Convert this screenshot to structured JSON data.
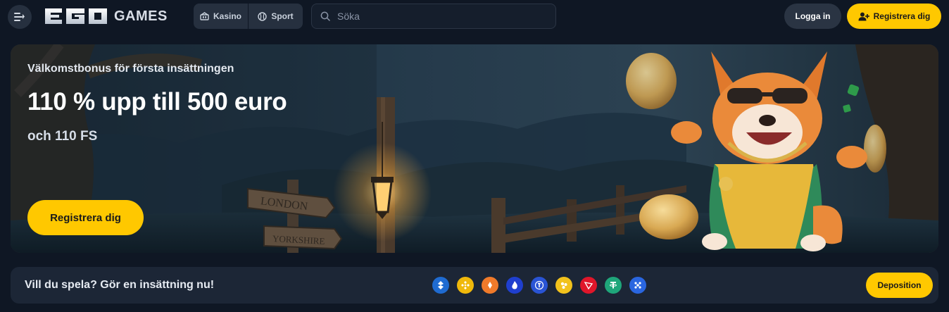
{
  "header": {
    "logo_ego": "EGO",
    "logo_games": "GAMES",
    "nav": [
      {
        "label": "Kasino",
        "icon": "casino-icon"
      },
      {
        "label": "Sport",
        "icon": "ball-icon"
      }
    ],
    "search": {
      "placeholder": "Söka"
    },
    "login_label": "Logga in",
    "register_label": "Registrera dig"
  },
  "banner": {
    "subtitle": "Välkomstbonus för första insättningen",
    "title": "110 % upp till 500 euro",
    "free_spins": "och 110 FS",
    "cta_label": "Registrera dig",
    "signpost_top": "LONDON",
    "signpost_bottom": "YORKSHIRE"
  },
  "deposit": {
    "text": "Vill du spela? Gör en insättning nu!",
    "button_label": "Deposition",
    "coins": [
      {
        "name": "bitcoin-cash-icon",
        "color": "#1f6bd1"
      },
      {
        "name": "binance-icon",
        "color": "#f0b90b"
      },
      {
        "name": "litecoin-icon",
        "color": "#f07a2a"
      },
      {
        "name": "flame-icon",
        "color": "#1f3fcf"
      },
      {
        "name": "tether-icon",
        "color": "#2a54d4"
      },
      {
        "name": "dogecoin-icon",
        "color": "#f2c21c"
      },
      {
        "name": "tron-icon",
        "color": "#e0162a"
      },
      {
        "name": "usdt-icon",
        "color": "#1fa67a"
      },
      {
        "name": "ripple-icon",
        "color": "#2a66e0"
      }
    ]
  },
  "colors": {
    "accent": "#ffc800",
    "background": "#0f1724",
    "surface": "#1c2636"
  }
}
